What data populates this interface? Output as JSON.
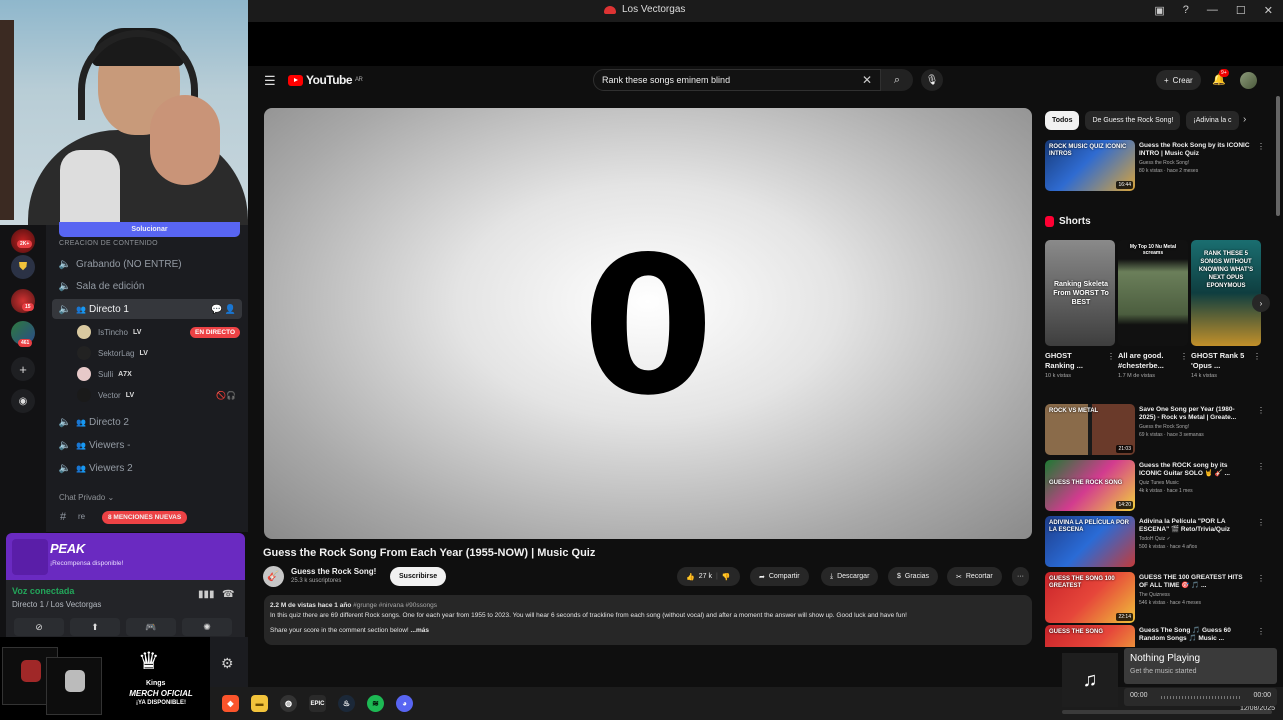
{
  "window": {
    "title": "Los Vectorgas",
    "minimize": "—",
    "maximize": "☐",
    "close": "✕"
  },
  "youtube": {
    "logo_text": "YouTube",
    "logo_region": "AR",
    "search": {
      "value": "Rank these songs eminem blind",
      "placeholder": "Buscar"
    },
    "create_label": "Crear",
    "notif_badge": "9+",
    "video": {
      "big_digit": "0",
      "title": "Guess the Rock Song From Each Year (1955-NOW) | Music Quiz",
      "channel": "Guess the Rock Song!",
      "subscribers": "25.3 k suscriptores",
      "subscribe_label": "Suscribirse",
      "likes": "27 k",
      "share_label": "Compartir",
      "download_label": "Descargar",
      "thanks_label": "Gracias",
      "clip_label": "Recortar",
      "more_label": "···",
      "desc_meta": "2.2 M de vistas  hace 1 año",
      "desc_tags": "#grunge #nirvana #90ssongs",
      "desc_line1": "In this quiz there are 69 different Rock songs. One for each year from 1955 to 2023. You will hear 6 seconds of trackline from each song (without vocal) and after a moment the answer will show up. Good luck and have fun!",
      "desc_line2": "Share your score in the comment section below!",
      "desc_more": "...más"
    },
    "chips": [
      "Todos",
      "De Guess the Rock Song!",
      "¡Adivina la c"
    ],
    "rec_top": {
      "title": "Guess the Rock Song by its ICONIC INTRO | Music Quiz",
      "channel": "Guess the Rock Song!",
      "views": "80 k vistas · hace 2 meses",
      "duration": "16:44",
      "thumb_text": "ROCK MUSIC QUIZ ICONIC INTROS"
    },
    "shorts_label": "Shorts",
    "shorts": [
      {
        "title": "GHOST Ranking ...",
        "views": "10 k vistas",
        "thumb_text": "Ranking Skeleta From WORST To BEST"
      },
      {
        "title": "All are good. #chesterbe...",
        "views": "1.7 M de vistas",
        "thumb_text": "My Top 10 Nu Metal screams"
      },
      {
        "title": "GHOST Rank 5 'Opus ...",
        "views": "14 k vistas",
        "thumb_text": "RANK THESE 5 SONGS WITHOUT KNOWING WHAT'S NEXT OPUS EPONYMOUS"
      }
    ],
    "recs": [
      {
        "title": "Save One Song per Year (1980-2025) - Rock vs Metal | Greate...",
        "channel": "Guess the Rock Song!",
        "views": "69 k vistas · hace 3 semanas",
        "duration": "21:03",
        "thumb_text": "ROCK VS METAL"
      },
      {
        "title": "Guess the ROCK song by its ICONIC Guitar SOLO 🤘 🎸 ...",
        "channel": "Quiz Tunes Music",
        "views": "4k k vistas · hace 1 mes",
        "duration": "14:20",
        "thumb_text": "GUESS THE ROCK SONG"
      },
      {
        "title": "Adivina la Película \"POR LA ESCENA\" 🎬 Reto/Trivia/Quiz",
        "channel": "TodoH Quiz ✓",
        "views": "500 k vistas · hace 4 años",
        "duration": "",
        "thumb_text": "ADIVINA LA PELÍCULA POR LA ESCENA"
      },
      {
        "title": "GUESS THE 100 GREATEST HITS OF ALL TIME 🎯 🎵 ...",
        "channel": "The Quizness",
        "views": "546 k vistas · hace 4 meses",
        "duration": "22:14",
        "thumb_text": "GUESS THE SONG 100 GREATEST"
      },
      {
        "title": "Guess The Song 🎵 Guess 60 Random Songs 🎵 Music ...",
        "channel": "",
        "views": "",
        "duration": "",
        "thumb_text": "GUESS THE SONG"
      }
    ]
  },
  "discord": {
    "solucionar_label": "Solucionar",
    "category": "CREACIÓN DE CONTENIDO",
    "channels": [
      {
        "name": "Grabando (NO ENTRE)"
      },
      {
        "name": "Sala de edición"
      },
      {
        "name": "Directo 1"
      }
    ],
    "members": [
      {
        "name": "IsTincho",
        "tag": "LV",
        "live": "EN DIRECTO"
      },
      {
        "name": "SektorLag",
        "tag": "LV"
      },
      {
        "name": "Sulli",
        "tag": "A7X"
      },
      {
        "name": "Vector",
        "tag": "LV"
      }
    ],
    "channels2": [
      {
        "name": "Directo 2"
      },
      {
        "name": "Viewers -"
      },
      {
        "name": "Viewers 2"
      }
    ],
    "chat_privado": "Chat Privado ⌄",
    "mentions_pre": "re",
    "mentions": "8 MENCIONES NUEVAS",
    "server_badges": [
      "2K+",
      "15",
      "461"
    ],
    "peak_title": "PEAK",
    "peak_sub": "¡Recompensa disponible!",
    "voice_connected": "Voz conectada",
    "voice_location": "Directo 1 / Los Vectorgas"
  },
  "merch": {
    "brand": "Kings",
    "title": "MERCH OFICIAL",
    "sub": "¡YA DISPONIBLE!"
  },
  "now_playing": {
    "title": "Nothing Playing",
    "subtitle": "Get the music started",
    "time_start": "00:00",
    "time_end": "00:00"
  },
  "tray": {
    "lang": "ESP\nLAA",
    "date": "12/08/2025"
  }
}
